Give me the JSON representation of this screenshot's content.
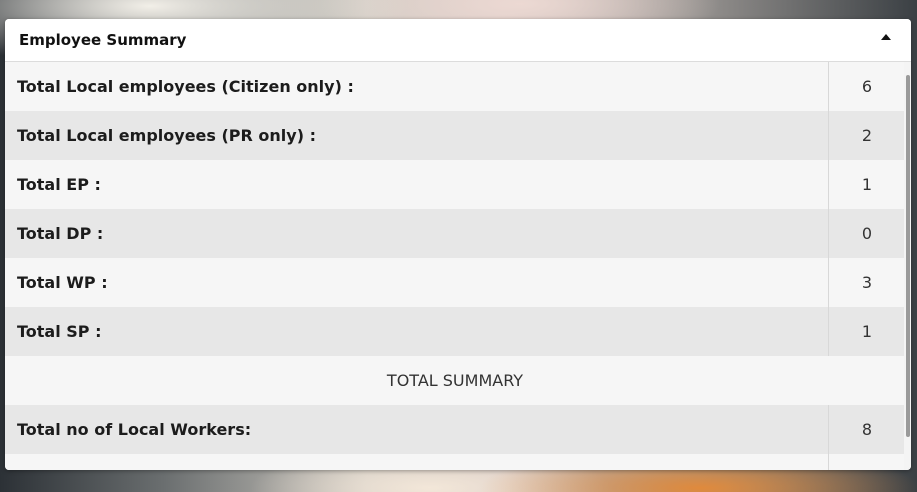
{
  "panel": {
    "title": "Employee Summary"
  },
  "rows": [
    {
      "label": "Total Local employees (Citizen only) :",
      "value": "6"
    },
    {
      "label": "Total Local employees (PR only) :",
      "value": "2"
    },
    {
      "label": "Total EP :",
      "value": "1"
    },
    {
      "label": "Total DP :",
      "value": "0"
    },
    {
      "label": "Total WP :",
      "value": "3"
    },
    {
      "label": "Total SP :",
      "value": "1"
    }
  ],
  "summary_heading": "TOTAL SUMMARY",
  "summary_rows": [
    {
      "label": "Total no of Local Workers:",
      "value": "8"
    },
    {
      "label": "",
      "value": ""
    }
  ]
}
